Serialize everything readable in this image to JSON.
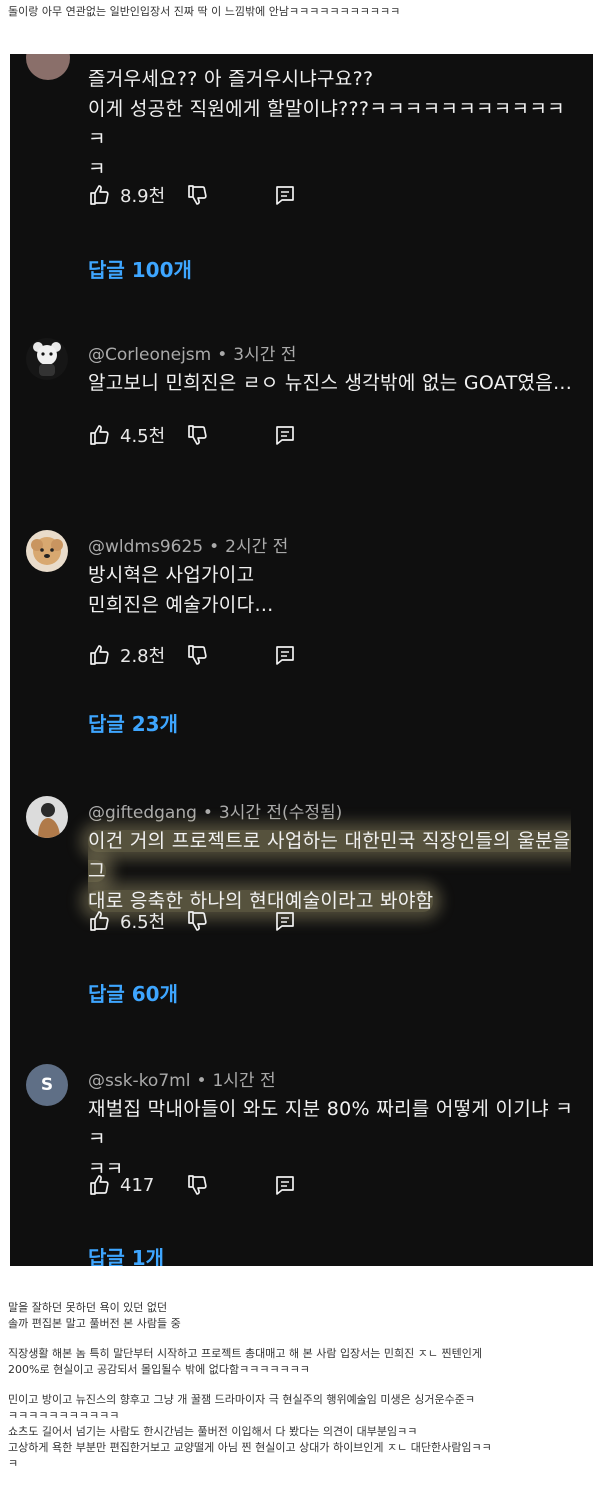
{
  "caption": "돌이랑 아무 연관없는 일반인입장서 진짜 딱 이 느낌밖에 안남ㅋㅋㅋㅋㅋㅋㅋㅋㅋㅋㅋ",
  "comments": [
    {
      "body_lines": [
        "즐거우세요?? 아 즐거우시냐구요??",
        "이게 성공한 직원에게 할말이냐???ㅋㅋㅋㅋㅋㅋㅋㅋㅋㅋㅋㅋ",
        "ㅋ"
      ],
      "likes": "8.9천",
      "replies": "답글 100개"
    },
    {
      "handle": "@Corleonejsm",
      "time": "3시간 전",
      "body_lines": [
        "알고보니 민희진은 ㄹㅇ 뉴진스 생각밖에 없는 GOAT였음..."
      ],
      "likes": "4.5천"
    },
    {
      "handle": "@wldms9625",
      "time": "2시간 전",
      "body_lines": [
        "방시혁은 사업가이고",
        "민희진은 예술가이다…"
      ],
      "likes": "2.8천",
      "replies": "답글 23개"
    },
    {
      "handle": "@giftedgang",
      "time": "3시간 전(수정됨)",
      "body_lines": [
        "이건 거의 프로젝트로 사업하는 대한민국 직장인들의 울분을 그",
        "대로 응축한 하나의 현대예술이라고 봐야함"
      ],
      "likes": "6.5천",
      "replies": "답글 60개"
    },
    {
      "handle": "@ssk-ko7ml",
      "time": "1시간 전",
      "avatar_letter": "S",
      "body_lines": [
        "재벌집 막내아들이 와도 지분 80% 짜리를 어떻게 이기냐 ㅋㅋ",
        "ㅋㅋ"
      ],
      "likes": "417",
      "replies": "답글 1개"
    }
  ],
  "bottom_paragraphs": [
    [
      "말을 잘하던 못하던 욕이 있던 없던",
      "솔까 편집본 말고 풀버전 본 사람들 중"
    ],
    [
      "직장생활 해본 놈 특히 말단부터 시작하고 프로젝트 총대매고 해 본 사람 입장서는 민희진 ㅈㄴ 찐텐인게",
      "200%로 현실이고 공감되서 몰입될수 밖에 없다함ㅋㅋㅋㅋㅋㅋㅋ"
    ],
    [
      "민이고 방이고 뉴진스의 향후고 그냥 개 꿀잼 드라마이자 극 현실주의 행위예술임 미생은 싱거운수준ㅋ",
      "ㅋㅋㅋㅋㅋㅋㅋㅋㅋㅋㅋ",
      "쇼츠도 길어서 넘기는 사람도 한시간넘는 풀버전 이입해서 다 봤다는 의견이 대부분임ㅋㅋ",
      "고상하게 욕한 부분만 편집한거보고 교양떨게 아님 찐 현실이고 상대가 하이브인게 ㅈㄴ 대단한사람임ㅋㅋ",
      "ㅋ"
    ]
  ],
  "colors": {
    "panel_bg": "#0f0f0f",
    "link_blue": "#3ea6ff",
    "meta_gray": "#aaaaaa"
  }
}
